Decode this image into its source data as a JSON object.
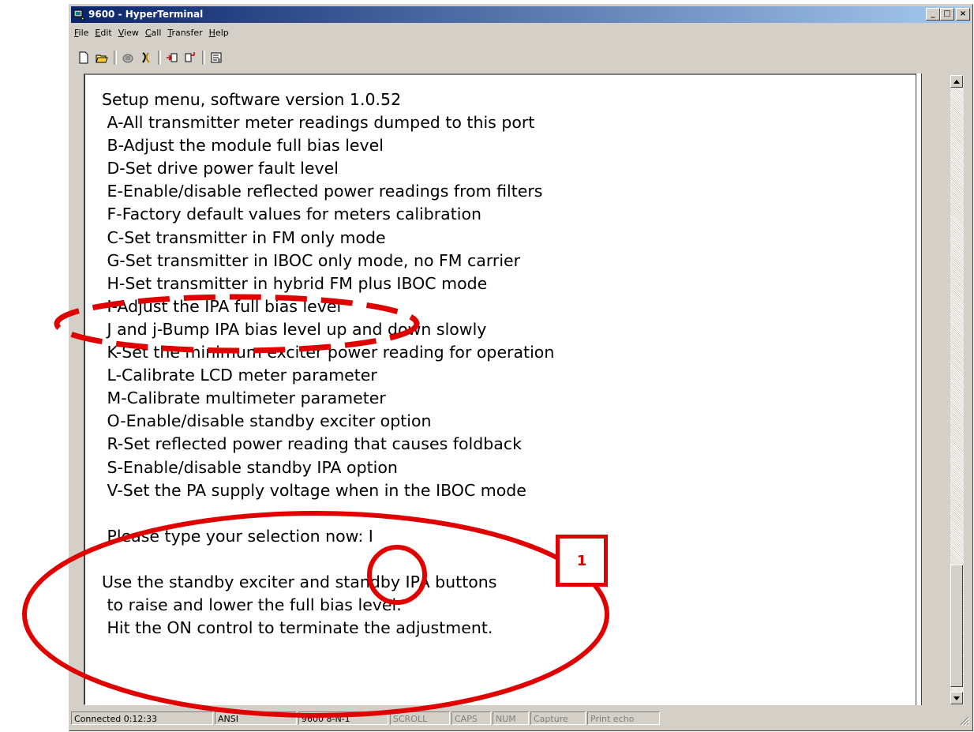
{
  "window": {
    "title": "9600 - HyperTerminal",
    "caption_buttons": {
      "minimize": "_",
      "maximize": "□",
      "close": "×"
    }
  },
  "menu": [
    {
      "accel": "F",
      "rest": "ile"
    },
    {
      "accel": "E",
      "rest": "dit"
    },
    {
      "accel": "V",
      "rest": "iew"
    },
    {
      "accel": "C",
      "rest": "all"
    },
    {
      "accel": "T",
      "rest": "ransfer"
    },
    {
      "accel": "H",
      "rest": "elp"
    }
  ],
  "toolbar_icons": [
    "new-icon",
    "open-icon",
    "phone-icon",
    "disconnect-icon",
    "send-icon",
    "receive-icon",
    "properties-icon"
  ],
  "terminal": {
    "lines": [
      "Setup menu, software version 1.0.52",
      " A-All transmitter meter readings dumped to this port",
      " B-Adjust the module full bias level",
      " D-Set drive power fault level",
      " E-Enable/disable reflected power readings from filters",
      " F-Factory default values for meters calibration",
      " C-Set transmitter in FM only mode",
      " G-Set transmitter in IBOC only mode, no FM carrier",
      " H-Set transmitter in hybrid FM plus IBOC mode",
      " I-Adjust the IPA full bias level",
      " J and j-Bump IPA bias level up and down slowly",
      " K-Set the minimum exciter power reading for operation",
      " L-Calibrate LCD meter parameter",
      " M-Calibrate multimeter parameter",
      " O-Enable/disable standby exciter option",
      " R-Set reflected power reading that causes foldback",
      " S-Enable/disable standby IPA option",
      " V-Set the PA supply voltage when in the IBOC mode",
      "",
      " Please type your selection now: I",
      "",
      "Use the standby exciter and standby IPA buttons",
      " to raise and lower the full bias level.",
      " Hit the ON control to terminate the adjustment."
    ]
  },
  "annotation": {
    "badge_label": "1",
    "color": "#e00000"
  },
  "statusbar": {
    "connected": "Connected 0:12:33",
    "emulation": "ANSI",
    "settings": "9600 8-N-1",
    "scroll": "SCROLL",
    "caps": "CAPS",
    "num": "NUM",
    "capture": "Capture",
    "print_echo": "Print echo"
  }
}
